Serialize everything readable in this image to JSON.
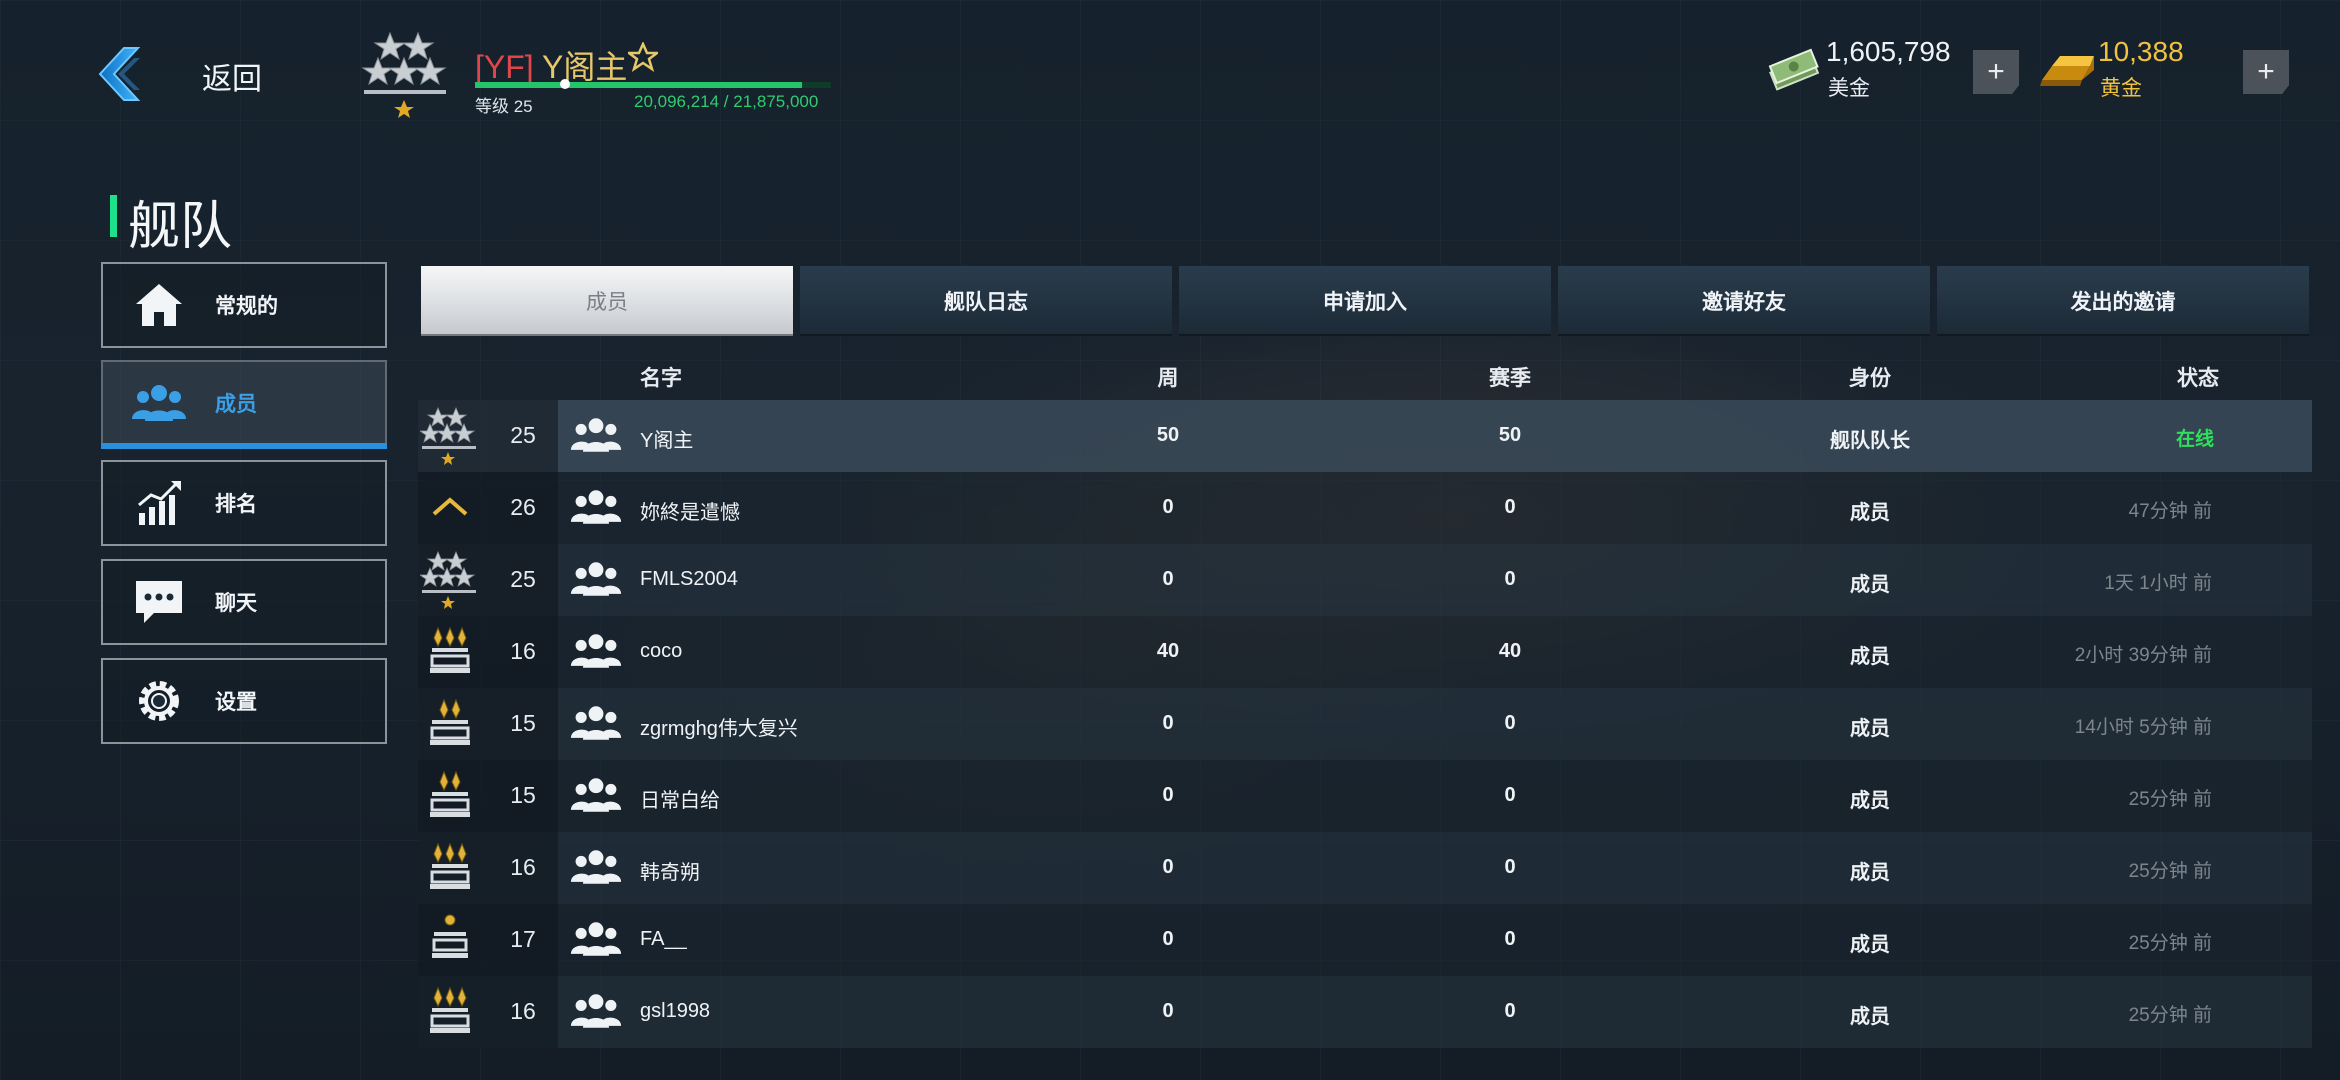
{
  "header": {
    "back_label": "返回",
    "player": {
      "tag": "[YF]",
      "name": "Y阁主",
      "level_label": "等级 25",
      "xp_text": "20,096,214 / 21,875,000",
      "xp_progress": 0.919
    },
    "currencies": {
      "cash": {
        "value": "1,605,798",
        "label": "美金"
      },
      "gold": {
        "value": "10,388",
        "label": "黄金"
      },
      "plus_label": "+"
    }
  },
  "section_title": "舰队",
  "sidebar": {
    "items": [
      {
        "label": "常规的",
        "icon": "home-icon"
      },
      {
        "label": "成员",
        "icon": "members-icon",
        "active": true
      },
      {
        "label": "排名",
        "icon": "ranking-icon"
      },
      {
        "label": "聊天",
        "icon": "chat-icon"
      },
      {
        "label": "设置",
        "icon": "gear-icon"
      }
    ]
  },
  "tabs": [
    {
      "label": "成员",
      "active": true
    },
    {
      "label": "舰队日志"
    },
    {
      "label": "申请加入"
    },
    {
      "label": "邀请好友"
    },
    {
      "label": "发出的邀请"
    }
  ],
  "table": {
    "headers": {
      "name": "名字",
      "week": "周",
      "season": "赛季",
      "role": "身份",
      "status": "状态"
    },
    "rows": [
      {
        "rank": "stars",
        "level": "25",
        "name": "Y阁主",
        "week": "50",
        "season": "50",
        "role": "舰队队长",
        "status": "在线",
        "online": true
      },
      {
        "rank": "chevron",
        "level": "26",
        "name": "妳終是遣憾",
        "week": "0",
        "season": "0",
        "role": "成员",
        "status": "47分钟 前"
      },
      {
        "rank": "stars",
        "level": "25",
        "name": "FMLS2004",
        "week": "0",
        "season": "0",
        "role": "成员",
        "status": "1天 1小时 前"
      },
      {
        "rank": "triple",
        "level": "16",
        "name": "coco",
        "week": "40",
        "season": "40",
        "role": "成员",
        "status": "2小时 39分钟 前"
      },
      {
        "rank": "double",
        "level": "15",
        "name": "zgrmghg伟大复兴",
        "week": "0",
        "season": "0",
        "role": "成员",
        "status": "14小时 5分钟 前"
      },
      {
        "rank": "double",
        "level": "15",
        "name": "日常白给",
        "week": "0",
        "season": "0",
        "role": "成员",
        "status": "25分钟 前"
      },
      {
        "rank": "triple",
        "level": "16",
        "name": "韩奇朔",
        "week": "0",
        "season": "0",
        "role": "成员",
        "status": "25分钟 前"
      },
      {
        "rank": "single",
        "level": "17",
        "name": "FA__",
        "week": "0",
        "season": "0",
        "role": "成员",
        "status": "25分钟 前"
      },
      {
        "rank": "triple",
        "level": "16",
        "name": "gsl1998",
        "week": "0",
        "season": "0",
        "role": "成员",
        "status": "25分钟 前"
      }
    ]
  },
  "colors": {
    "accent_green": "#1fe08a",
    "accent_blue": "#2a8fdc",
    "gold": "#f0c23e",
    "tag_red": "#e2454a",
    "online": "#2ee05a"
  }
}
